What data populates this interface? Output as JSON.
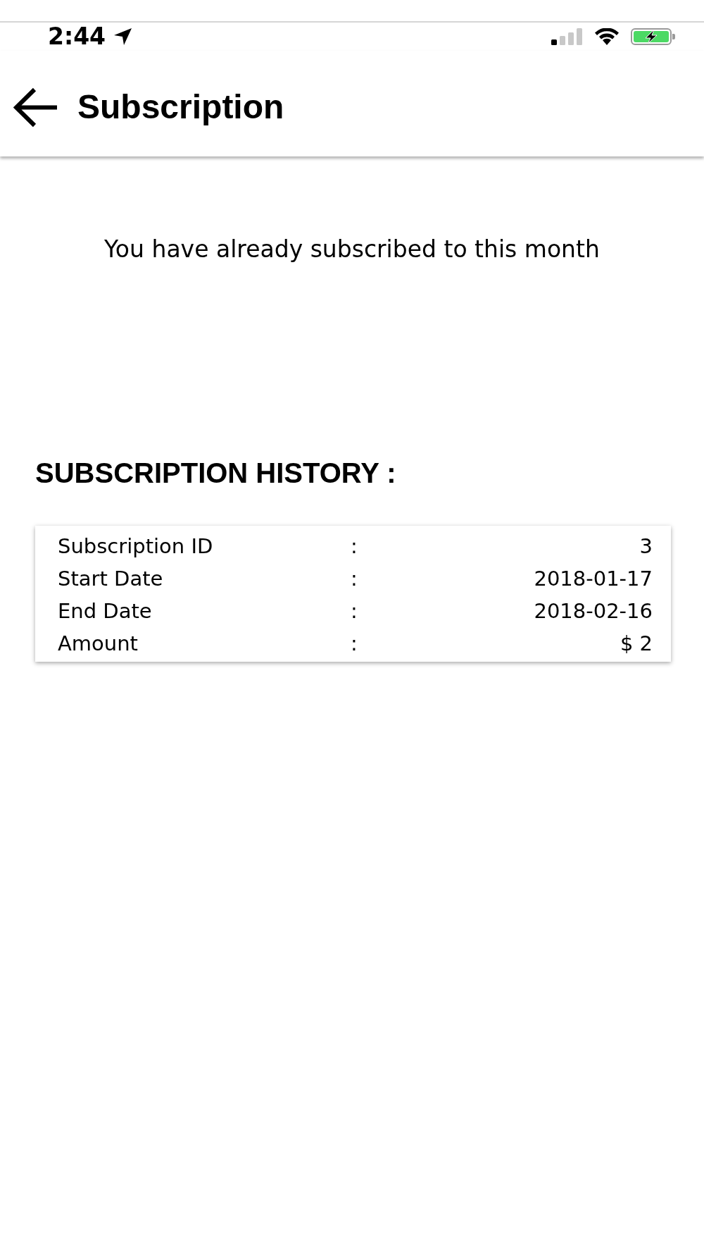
{
  "status_bar": {
    "time": "2:44"
  },
  "header": {
    "title": "Subscription"
  },
  "message": "You have already subscribed to this month",
  "history": {
    "title": "SUBSCRIPTION HISTORY :",
    "rows": [
      {
        "label": "Subscription ID",
        "separator": ":",
        "value": "3"
      },
      {
        "label": "Start Date",
        "separator": ":",
        "value": "2018-01-17"
      },
      {
        "label": "End Date",
        "separator": ":",
        "value": "2018-02-16"
      },
      {
        "label": "Amount",
        "separator": ":",
        "value": "$ 2"
      }
    ]
  }
}
